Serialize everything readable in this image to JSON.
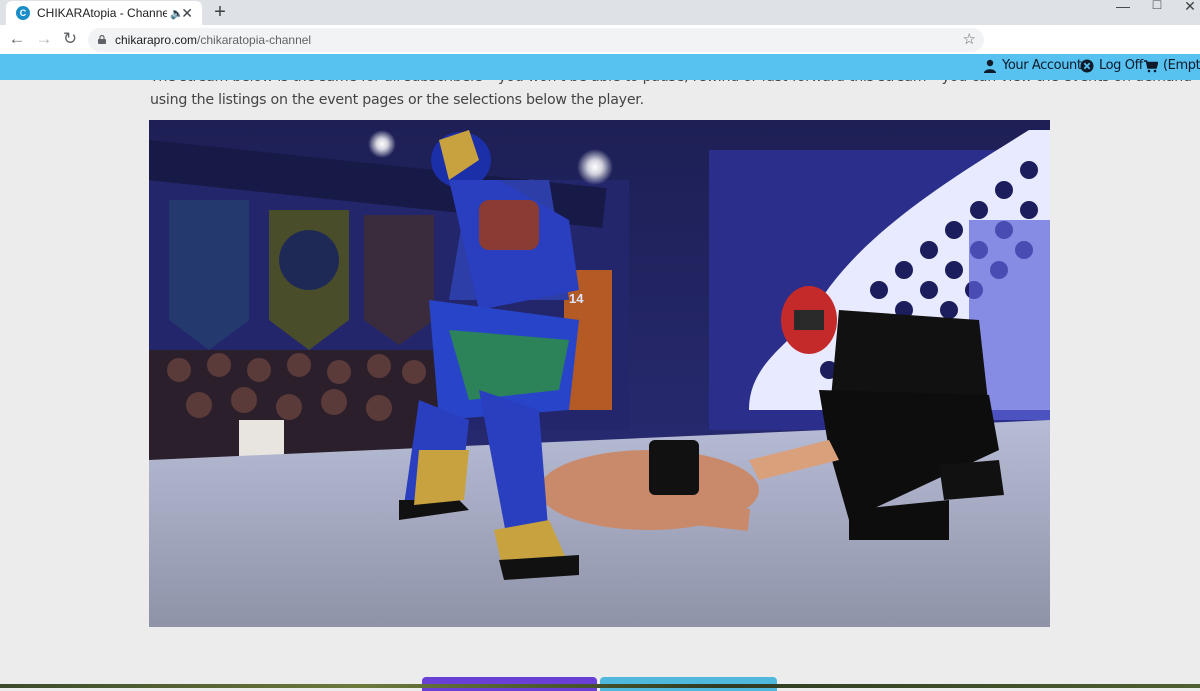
{
  "browser": {
    "tab": {
      "title": "CHIKARAtopia - Channel Stre",
      "favicon": "C",
      "audio_icon": "speaker-icon",
      "close_icon": "close-icon"
    },
    "new_tab_icon": "plus-icon",
    "window_controls": [
      "minimize-icon",
      "maximize-icon",
      "close-icon"
    ],
    "url": {
      "domain": "chikarapro.com",
      "path": "/chikaratopia-channel"
    }
  },
  "site_nav": {
    "account_label": "Your Account",
    "logoff_label": "Log Off",
    "cart_label": "(Empty)",
    "bar_color": "#57c1f0"
  },
  "content": {
    "intro_line1": "The stream below is the same for all subscribers – you won't be able to pause, rewind or fast-forward this stream – you can view the events on demand",
    "intro_line2": "using the listings on the event pages or the selections below the player.",
    "video_overlay_number": "14"
  },
  "colors": {
    "button_primary": "#6a3fd6",
    "button_secondary": "#4fb8dc"
  }
}
